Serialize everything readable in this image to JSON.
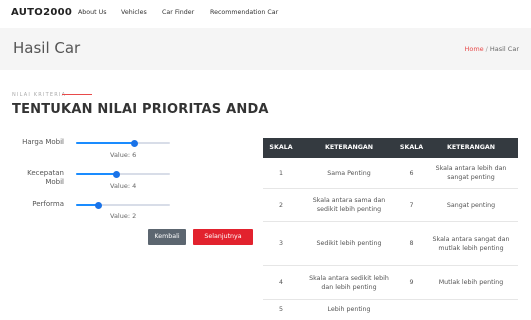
{
  "navbar": {
    "brand": "AUTO2000",
    "links": [
      "About Us",
      "Vehicles",
      "Car Finder",
      "Recommendation Car"
    ]
  },
  "header": {
    "title": "Hasil Car",
    "breadcrumb": {
      "home": "Home",
      "separator": "/",
      "current": "Hasil Car"
    }
  },
  "section": {
    "kicker": "NILAI KRITERIA",
    "title": "TENTUKAN NILAI PRIORITAS ANDA"
  },
  "criteria": [
    {
      "label": "Harga Mobil",
      "value_text": "Value: 6",
      "fraction": 0.62
    },
    {
      "label": "Kecepatan Mobil",
      "value_text": "Value: 4",
      "fraction": 0.42
    },
    {
      "label": "Performa",
      "value_text": "Value: 2",
      "fraction": 0.22
    }
  ],
  "buttons": {
    "back": "Kembali",
    "next": "Selanjutnya"
  },
  "scale_table": {
    "headers": [
      "SKALA",
      "KETERANGAN",
      "SKALA",
      "KETERANGAN"
    ],
    "rows": [
      [
        "1",
        "Sama Penting",
        "6",
        "Skala antara lebih dan sangat penting"
      ],
      [
        "2",
        "Skala antara sama dan sedikit lebih penting",
        "7",
        "Sangat penting"
      ],
      [
        "3",
        "Sedikit lebih penting",
        "8",
        "Skala antara sangat dan mutlak lebih penting"
      ],
      [
        "4",
        "Skala antara sedikit lebih dan lebih penting",
        "9",
        "Mutlak lebih penting"
      ],
      [
        "5",
        "Lebih penting",
        "",
        ""
      ]
    ]
  },
  "colors": {
    "accent": "#e2222e",
    "slider": "#1a73e8",
    "table_header": "#343a40"
  }
}
